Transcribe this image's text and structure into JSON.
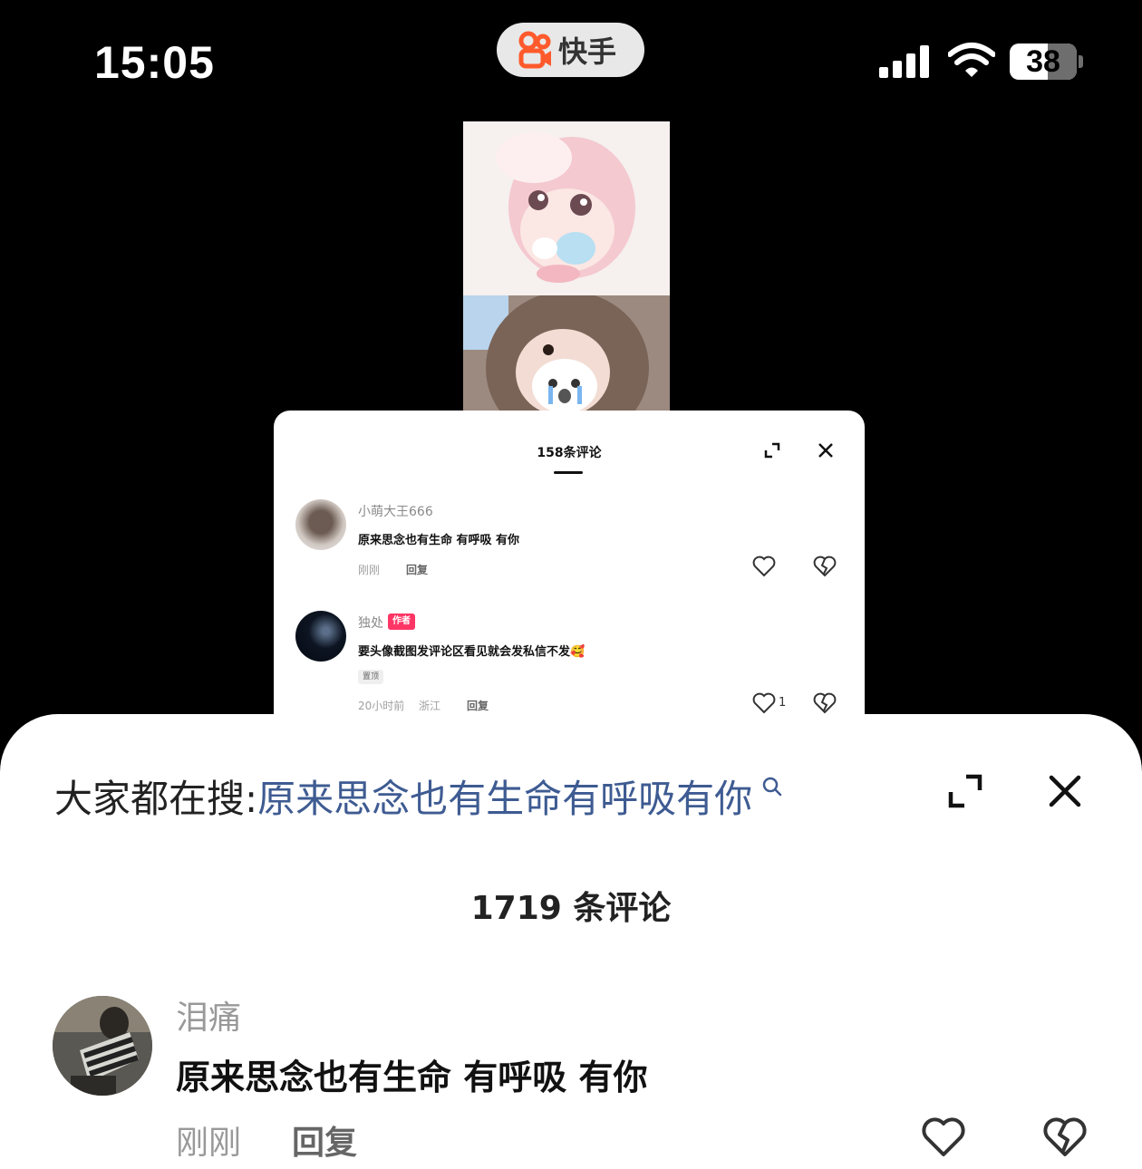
{
  "status_bar": {
    "time": "15:05",
    "app_name": "快手",
    "battery": "38"
  },
  "inner_screenshot": {
    "title": "158条评论",
    "comments": [
      {
        "username": "小萌大王666",
        "text": "原来思念也有生命 有呼吸 有你",
        "time": "刚刚",
        "reply": "回复"
      },
      {
        "username": "独处",
        "author_tag": "作者",
        "text": "要头像截图发评论区看见就会发私信不发🥰",
        "pin_tag": "置顶",
        "time": "20小时前",
        "location": "浙江",
        "reply": "回复",
        "likes": "1"
      }
    ]
  },
  "sheet": {
    "search_prefix": "大家都在搜:",
    "search_term": "原来思念也有生命有呼吸有你",
    "comment_count": "1719 条评论",
    "comment": {
      "username": "泪痛",
      "text": "原来思念也有生命 有呼吸 有你",
      "time": "刚刚",
      "reply": "回复"
    }
  },
  "colors": {
    "search_term": "#3e5b92",
    "author_tag": "#fe3666",
    "app_logo": "#ff5a2c"
  }
}
